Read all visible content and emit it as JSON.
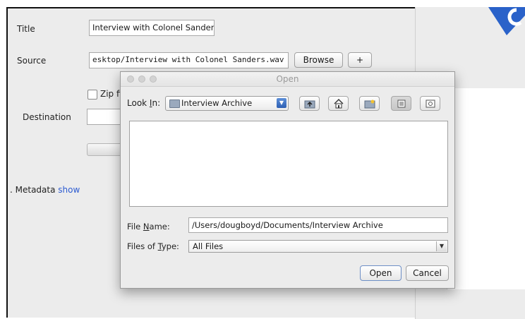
{
  "form": {
    "title_label": "Title",
    "title_value": "Interview with Colonel Sanders",
    "source_label": "Source",
    "source_value": "esktop/Interview with Colonel Sanders.wav",
    "browse_label": "Browse",
    "add_label": "+",
    "zip_label": "Zip fi",
    "destination_label": "Destination",
    "metadata_label": ". Metadata",
    "metadata_link": "show"
  },
  "dialog": {
    "title": "Open",
    "look_in_label_pre": "Look ",
    "look_in_label_mn": "I",
    "look_in_label_post": "n:",
    "look_in_value": "Interview Archive",
    "file_name_label_pre": "File ",
    "file_name_label_mn": "N",
    "file_name_label_post": "ame:",
    "file_name_value": "/Users/dougboyd/Documents/Interview Archive",
    "files_of_type_label_pre": "Files of ",
    "files_of_type_label_mn": "T",
    "files_of_type_label_post": "ype:",
    "files_of_type_value": "All Files",
    "open_label": "Open",
    "cancel_label": "Cancel",
    "toolbar_icons": [
      "up-folder-icon",
      "home-icon",
      "new-folder-icon",
      "list-view-icon",
      "details-view-icon"
    ]
  },
  "colors": {
    "link": "#2c5bd1",
    "logo": "#2a62c9",
    "combo_arrow": "#2d5fb3"
  }
}
